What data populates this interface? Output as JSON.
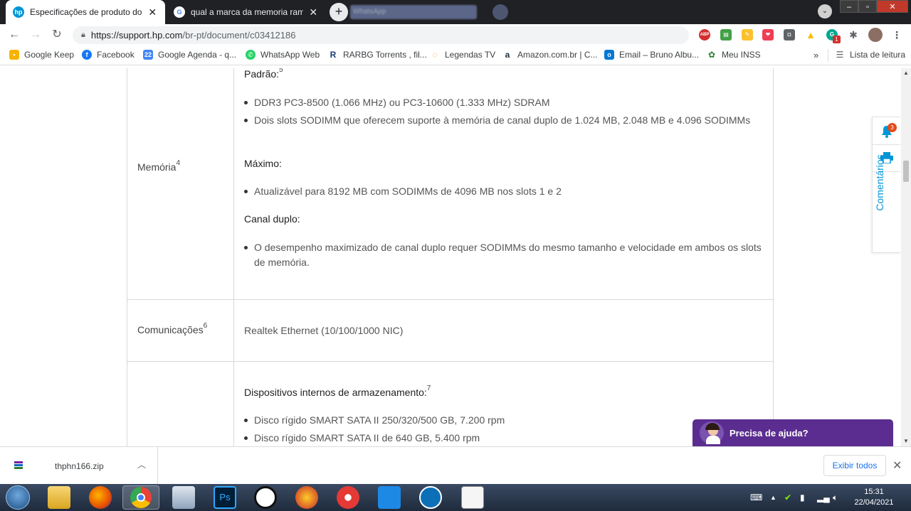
{
  "browser": {
    "tabs": [
      {
        "title": "Especificações de produto do no",
        "active": true,
        "favicon": "hp-logo-icon"
      },
      {
        "title": "qual a marca da memoria ram do",
        "active": false,
        "favicon": "google-icon"
      }
    ],
    "blurred_tab": "WhatsApp",
    "url_host": "https://support.hp.com",
    "url_path": "/br-pt/document/c03412186",
    "extension_badge": "1"
  },
  "bookmarks": [
    {
      "label": "Google Keep",
      "icon": "keep-icon",
      "color": "#f6b400"
    },
    {
      "label": "Facebook",
      "icon": "facebook-icon",
      "color": "#1877f2"
    },
    {
      "label": "Google Agenda - q...",
      "icon": "calendar-icon",
      "color": "#4285f4"
    },
    {
      "label": "WhatsApp Web",
      "icon": "whatsapp-icon",
      "color": "#25d366"
    },
    {
      "label": "RARBG Torrents , fil...",
      "icon": "rarbg-icon",
      "color": "#1b3a7a"
    },
    {
      "label": "Legendas TV",
      "icon": "legendas-icon",
      "color": "#f39c12"
    },
    {
      "label": "Amazon.com.br | C...",
      "icon": "amazon-icon",
      "color": "#232f3e"
    },
    {
      "label": "Email – Bruno Albu...",
      "icon": "outlook-icon",
      "color": "#0078d4"
    },
    {
      "label": "Meu INSS",
      "icon": "inss-icon",
      "color": "#2e7d32"
    }
  ],
  "bookmarks_more": "»",
  "reading_list": "Lista de leitura",
  "spec": {
    "memory": {
      "label": "Memória",
      "label_sup": "4",
      "standard_heading": "Padrão:",
      "standard_sup": "5",
      "standard_items": [
        "DDR3 PC3-8500 (1.066 MHz) ou PC3-10600 (1.333 MHz) SDRAM",
        "Dois slots SODIMM que oferecem suporte à memória de canal duplo de 1.024 MB, 2.048 MB e 4.096 SODIMMs"
      ],
      "max_heading": "Máximo:",
      "max_items": [
        "Atualizável para 8192 MB com SODIMMs de 4096 MB nos slots 1 e 2"
      ],
      "dual_heading": "Canal duplo:",
      "dual_items": [
        "O desempenho maximizado de canal duplo requer SODIMMs do mesmo tamanho e velocidade em ambos os slots de memória."
      ]
    },
    "comms": {
      "label": "Comunicações",
      "label_sup": "6",
      "value": "Realtek Ethernet (10/100/1000 NIC)"
    },
    "storage": {
      "heading": "Dispositivos internos de armazenamento:",
      "heading_sup": "7",
      "items": [
        "Disco rígido SMART SATA II 250/320/500 GB, 7.200 rpm",
        "Disco rígido SMART SATA II de 640 GB, 5.400 rpm"
      ]
    }
  },
  "side_widget": {
    "notification_count": "3",
    "comments_label": "Comentários"
  },
  "help_chat": {
    "label": "Precisa de ajuda?"
  },
  "downloads": {
    "file_name": "thphn166.zip",
    "show_all": "Exibir todos"
  },
  "taskbar": {
    "time": "15:31",
    "date": "22/04/2021"
  },
  "colors": {
    "hp_blue": "#0096d6",
    "chat_purple": "#5b2d90",
    "link_blue": "#1a73e8"
  }
}
